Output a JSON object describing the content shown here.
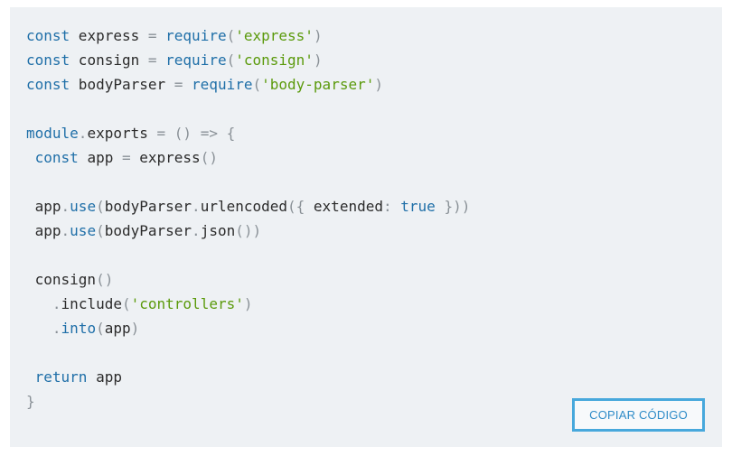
{
  "code": {
    "lines": [
      [
        {
          "t": "const",
          "c": "kw"
        },
        {
          "t": " express ",
          "c": "pl"
        },
        {
          "t": "=",
          "c": "op"
        },
        {
          "t": " ",
          "c": "pl"
        },
        {
          "t": "require",
          "c": "fn"
        },
        {
          "t": "(",
          "c": "op"
        },
        {
          "t": "'express'",
          "c": "str"
        },
        {
          "t": ")",
          "c": "op"
        }
      ],
      [
        {
          "t": "const",
          "c": "kw"
        },
        {
          "t": " consign ",
          "c": "pl"
        },
        {
          "t": "=",
          "c": "op"
        },
        {
          "t": " ",
          "c": "pl"
        },
        {
          "t": "require",
          "c": "fn"
        },
        {
          "t": "(",
          "c": "op"
        },
        {
          "t": "'consign'",
          "c": "str"
        },
        {
          "t": ")",
          "c": "op"
        }
      ],
      [
        {
          "t": "const",
          "c": "kw"
        },
        {
          "t": " bodyParser ",
          "c": "pl"
        },
        {
          "t": "=",
          "c": "op"
        },
        {
          "t": " ",
          "c": "pl"
        },
        {
          "t": "require",
          "c": "fn"
        },
        {
          "t": "(",
          "c": "op"
        },
        {
          "t": "'body-parser'",
          "c": "str"
        },
        {
          "t": ")",
          "c": "op"
        }
      ],
      [],
      [
        {
          "t": "module",
          "c": "kw"
        },
        {
          "t": ".",
          "c": "op"
        },
        {
          "t": "exports ",
          "c": "pl"
        },
        {
          "t": "=",
          "c": "op"
        },
        {
          "t": " ",
          "c": "pl"
        },
        {
          "t": "()",
          "c": "op"
        },
        {
          "t": " ",
          "c": "pl"
        },
        {
          "t": "=>",
          "c": "op"
        },
        {
          "t": " ",
          "c": "pl"
        },
        {
          "t": "{",
          "c": "op"
        }
      ],
      [
        {
          "t": " ",
          "c": "pl"
        },
        {
          "t": "const",
          "c": "kw"
        },
        {
          "t": " app ",
          "c": "pl"
        },
        {
          "t": "=",
          "c": "op"
        },
        {
          "t": " express",
          "c": "pl"
        },
        {
          "t": "()",
          "c": "op"
        }
      ],
      [],
      [
        {
          "t": " app",
          "c": "pl"
        },
        {
          "t": ".",
          "c": "op"
        },
        {
          "t": "use",
          "c": "fn"
        },
        {
          "t": "(",
          "c": "op"
        },
        {
          "t": "bodyParser",
          "c": "pl"
        },
        {
          "t": ".",
          "c": "op"
        },
        {
          "t": "urlencoded",
          "c": "pl"
        },
        {
          "t": "({",
          "c": "op"
        },
        {
          "t": " extended",
          "c": "pl"
        },
        {
          "t": ":",
          "c": "op"
        },
        {
          "t": " ",
          "c": "pl"
        },
        {
          "t": "true",
          "c": "kw"
        },
        {
          "t": " ",
          "c": "pl"
        },
        {
          "t": "}))",
          "c": "op"
        }
      ],
      [
        {
          "t": " app",
          "c": "pl"
        },
        {
          "t": ".",
          "c": "op"
        },
        {
          "t": "use",
          "c": "fn"
        },
        {
          "t": "(",
          "c": "op"
        },
        {
          "t": "bodyParser",
          "c": "pl"
        },
        {
          "t": ".",
          "c": "op"
        },
        {
          "t": "json",
          "c": "pl"
        },
        {
          "t": "())",
          "c": "op"
        }
      ],
      [],
      [
        {
          "t": " consign",
          "c": "pl"
        },
        {
          "t": "()",
          "c": "op"
        }
      ],
      [
        {
          "t": "   ",
          "c": "pl"
        },
        {
          "t": ".",
          "c": "op"
        },
        {
          "t": "include",
          "c": "pl"
        },
        {
          "t": "(",
          "c": "op"
        },
        {
          "t": "'controllers'",
          "c": "str"
        },
        {
          "t": ")",
          "c": "op"
        }
      ],
      [
        {
          "t": "   ",
          "c": "pl"
        },
        {
          "t": ".",
          "c": "op"
        },
        {
          "t": "into",
          "c": "fn"
        },
        {
          "t": "(",
          "c": "op"
        },
        {
          "t": "app",
          "c": "pl"
        },
        {
          "t": ")",
          "c": "op"
        }
      ],
      [],
      [
        {
          "t": " ",
          "c": "pl"
        },
        {
          "t": "return",
          "c": "kw"
        },
        {
          "t": " app",
          "c": "pl"
        }
      ],
      [
        {
          "t": "}",
          "c": "op"
        }
      ]
    ]
  },
  "toolbar": {
    "copy_label": "COPIAR CÓDIGO"
  },
  "colors": {
    "keyword": "#1f6fa8",
    "string": "#5b9a0c",
    "operator": "#8a9197",
    "plain": "#2b2b2b",
    "panel_bg": "#eef1f4",
    "button_border": "#47a8dc"
  }
}
